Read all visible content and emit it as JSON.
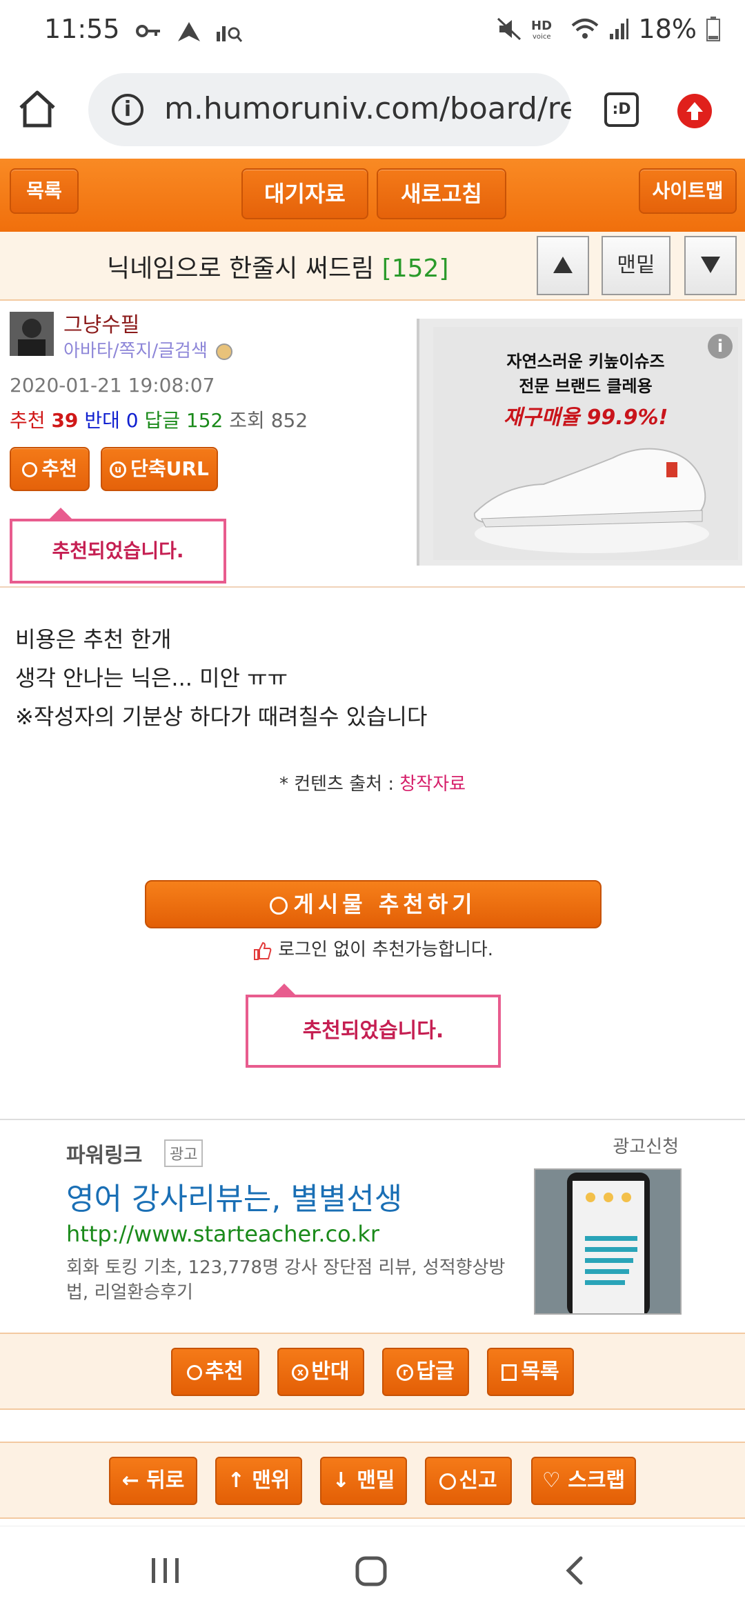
{
  "status_bar": {
    "time": "11:55",
    "battery": "18%"
  },
  "browser": {
    "url": "m.humoruniv.com/board/re",
    "tab_switcher_label": ":D"
  },
  "nav": {
    "list": "목록",
    "pending": "대기자료",
    "refresh": "새로고침",
    "sitemap": "사이트맵"
  },
  "post": {
    "title": "닉네임으로 한줄시 써드림",
    "comment_count_display": "[152]",
    "bottom_btn": "맨밑"
  },
  "author": {
    "name": "그냥수필",
    "links": "아바타/쪽지/글검색",
    "datetime": "2020-01-21 19:08:07",
    "stats": {
      "recommend_label": "추천",
      "recommend": "39",
      "oppose_label": "반대",
      "oppose": "0",
      "reply_label": "답글",
      "reply": "152",
      "views_label": "조회",
      "views": "852"
    },
    "recommend_btn": "추천",
    "short_url_btn": "단축URL",
    "recommended_msg": "추천되었습니다."
  },
  "ad_banner": {
    "line1": "자연스러운 키높이슈즈",
    "line2": "전문 브랜드 클레용",
    "line3": "재구매율 99.9%!",
    "info": "i"
  },
  "content": {
    "line1": "비용은 추천 한개",
    "line2": "생각 안나는 닉은... 미안 ㅠㅠ",
    "line3": "※작성자의 기분상 하다가 때려칠수 있습니다",
    "source_label": "* 컨텐츠 출처 :",
    "source_value": "창작자료",
    "recommend_post_btn": "게시물  추천하기",
    "login_note": "로그인 없이 추천가능합니다.",
    "recommended_msg": "추천되었습니다."
  },
  "powerlink": {
    "label": "파워링크",
    "ad_badge": "광고",
    "request": "광고신청",
    "title": "영어 강사리뷰는, 별별선생",
    "url": "http://www.starteacher.co.kr",
    "description": "회화 토킹 기초, 123,778명 강사 장단점 리뷰, 성적향상방법, 리얼환승후기"
  },
  "actions": {
    "recommend": "추천",
    "oppose": "반대",
    "reply": "답글",
    "list": "목록"
  },
  "footer_nav": {
    "back": "뒤로",
    "top": "맨위",
    "bottom": "맨밑",
    "report": "신고",
    "scrap": "스크랩"
  },
  "colors": {
    "accent_orange": "#f06f0c",
    "link_red": "#c51f52",
    "green": "#1a8a1a"
  }
}
